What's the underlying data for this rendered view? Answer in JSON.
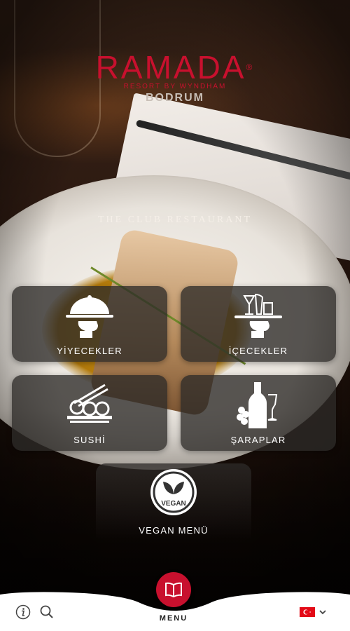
{
  "logo": {
    "brand": "RAMADA",
    "registered": "®",
    "subtitle": "RESORT BY WYNDHAM",
    "city": "BODRUM"
  },
  "restaurant_title": "THE CLUB RESTAURANT",
  "categories": [
    {
      "label": "YİYECEKLER",
      "icon": "food-cloche-icon"
    },
    {
      "label": "İÇECEKLER",
      "icon": "drinks-tray-icon"
    },
    {
      "label": "SUSHİ",
      "icon": "sushi-icon"
    },
    {
      "label": "ŞARAPLAR",
      "icon": "wine-bottle-icon"
    }
  ],
  "vegan": {
    "label": "VEGAN MENÜ",
    "badge_text": "VEGAN",
    "icon": "vegan-leaf-icon"
  },
  "bottom_nav": {
    "menu_label": "MENU",
    "menu_icon": "open-book-icon",
    "info_icon": "info-icon",
    "search_icon": "search-icon",
    "language_flag": "turkey-flag-icon",
    "language_dropdown_icon": "chevron-down-icon"
  },
  "colors": {
    "brand_red": "#c8102e",
    "tile_bg": "rgba(45,42,40,0.78)",
    "nav_bg": "#ffffff"
  }
}
